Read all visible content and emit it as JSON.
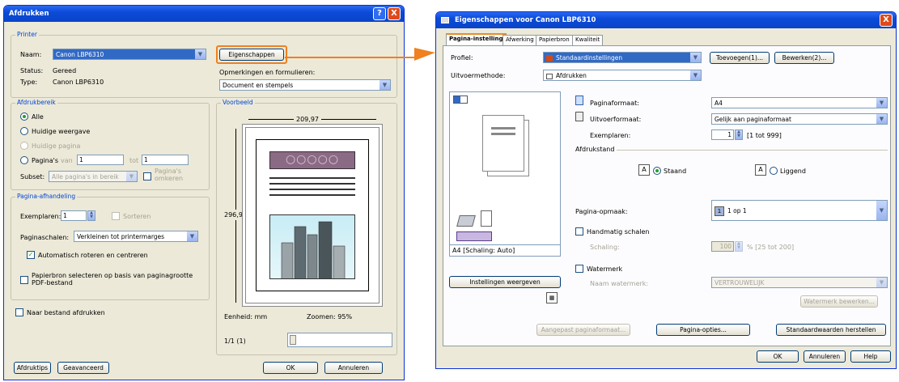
{
  "print_dialog": {
    "title": "Afdrukken",
    "help_btn": "?",
    "close_btn": "X",
    "printer_group": "Printer",
    "name_label": "Naam:",
    "name_value": "Canon LBP6310",
    "status_label": "Status:",
    "status_value": "Gereed",
    "type_label": "Type:",
    "type_value": "Canon LBP6310",
    "properties_btn": "Eigenschappen",
    "comments_label": "Opmerkingen en formulieren:",
    "comments_value": "Document en stempels",
    "range_group": "Afdrukbereik",
    "range_all": "Alle",
    "range_current_view": "Huidige weergave",
    "range_current_page": "Huidige pagina",
    "range_pages": "Pagina's",
    "range_from": "van",
    "range_from_value": "1",
    "range_to": "tot",
    "range_to_value": "1",
    "subset_label": "Subset:",
    "subset_value": "Alle pagina's in bereik",
    "reverse_pages": "Pagina's omkeren",
    "handling_group": "Pagina-afhandeling",
    "copies_label": "Exemplaren:",
    "copies_value": "1",
    "collate_label": "Sorteren",
    "scaling_label": "Paginaschalen:",
    "scaling_value": "Verkleinen tot printermarges",
    "autorotate_label": "Automatisch roteren en centreren",
    "pdf_paper_label": "Papierbron selecteren op basis van paginagrootte PDF-bestand",
    "print_to_file": "Naar bestand afdrukken",
    "preview_group": "Voorbeeld",
    "preview_width": "209,97",
    "preview_height": "296,93",
    "preview_unit": "Eenheid: mm",
    "preview_zoom": "Zoomen: 95%",
    "preview_page": "1/1 (1)",
    "tips_btn": "Afdruktips",
    "advanced_btn": "Geavanceerd",
    "ok_btn": "OK",
    "cancel_btn": "Annuleren"
  },
  "props_dialog": {
    "title": "Eigenschappen voor Canon LBP6310",
    "close_btn": "X",
    "tabs": [
      {
        "label": "Pagina-instelling"
      },
      {
        "label": "Afwerking"
      },
      {
        "label": "Papierbron"
      },
      {
        "label": "Kwaliteit"
      }
    ],
    "profile_label": "Profiel:",
    "profile_value": "Standaardinstellingen",
    "add_btn": "Toevoegen(1)...",
    "edit_btn": "Bewerken(2)...",
    "output_label": "Uitvoermethode:",
    "output_value": "Afdrukken",
    "page_size_label": "Paginaformaat:",
    "page_size_value": "A4",
    "output_size_label": "Uitvoerformaat:",
    "output_size_value": "Gelijk aan paginaformaat",
    "copies_label": "Exemplaren:",
    "copies_value": "1",
    "copies_range": "[1 tot 999]",
    "orientation_label": "Afdrukstand",
    "portrait_label": "Staand",
    "landscape_label": "Liggend",
    "layout_label": "Pagina-opmaak:",
    "layout_value": "1 op 1",
    "manual_scaling_label": "Handmatig schalen",
    "scaling_label": "Schaling:",
    "scaling_value": "100",
    "scaling_range": "% [25 tot 200]",
    "watermark_label": "Watermerk",
    "watermark_name_label": "Naam watermerk:",
    "watermark_name_value": "VERTROUWELIJK",
    "edit_watermark_btn": "Watermerk bewerken...",
    "preview_caption": "A4 [Schaling: Auto]",
    "view_settings_btn": "Instellingen weergeven",
    "custom_size_btn": "Aangepast paginaformaat...",
    "page_options_btn": "Pagina-opties...",
    "restore_defaults_btn": "Standaardwaarden herstellen",
    "ok_btn": "OK",
    "cancel_btn": "Annuleren",
    "help_btn": "Help"
  },
  "colors": {
    "highlight": "#f08020",
    "titlebar": "#0c4bd8",
    "group_label": "#0046d5"
  }
}
